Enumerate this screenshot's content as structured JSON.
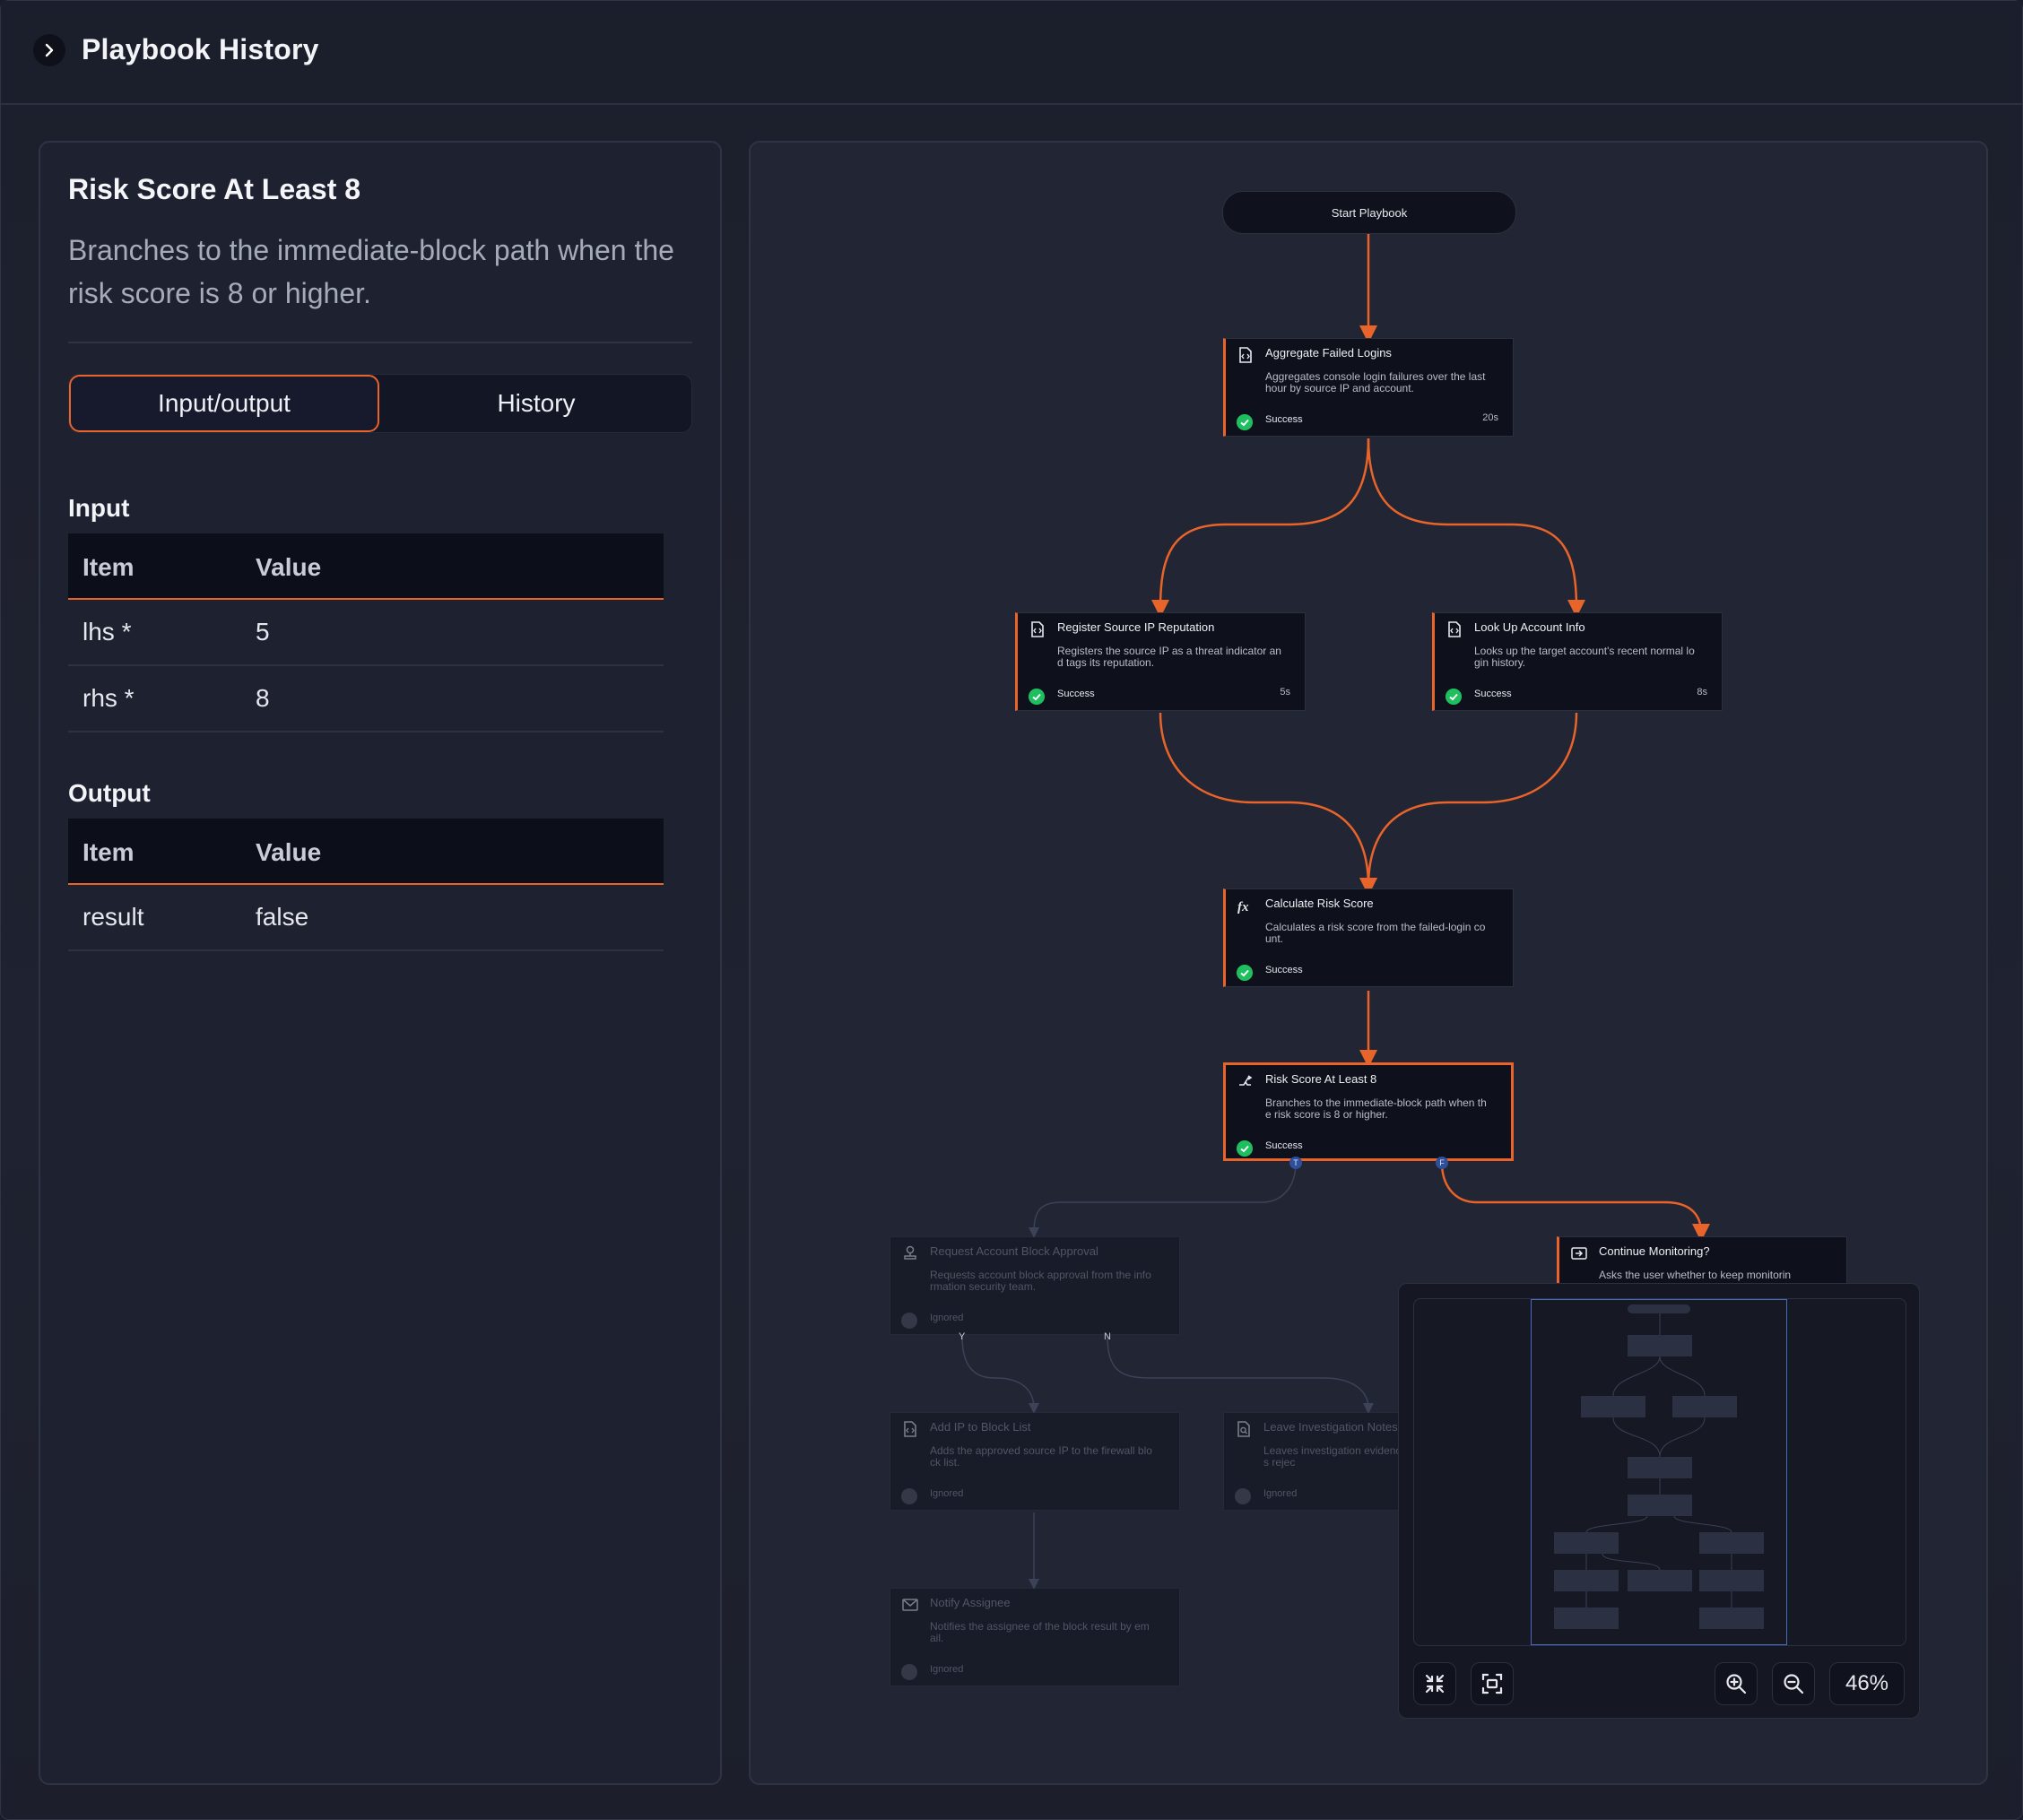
{
  "header": {
    "title": "Playbook History"
  },
  "detail": {
    "title": "Risk Score At Least 8",
    "description": "Branches to the immediate-block path when the risk score is 8 or higher.",
    "tabs": {
      "active": "Input/output",
      "inactive": "History"
    },
    "input": {
      "heading": "Input",
      "columns": [
        "Item",
        "Value"
      ],
      "rows": [
        {
          "item": "lhs *",
          "value": "5"
        },
        {
          "item": "rhs *",
          "value": "8"
        }
      ]
    },
    "output": {
      "heading": "Output",
      "columns": [
        "Item",
        "Value"
      ],
      "rows": [
        {
          "item": "result",
          "value": "false"
        }
      ]
    }
  },
  "flow": {
    "start": "Start Playbook",
    "nodes": {
      "aggregate": {
        "title": "Aggregate Failed Logins",
        "desc": "Aggregates console login failures over the last hour by source IP and account.",
        "status": "Success",
        "time": "20s"
      },
      "register": {
        "title": "Register Source IP Reputation",
        "desc": "Registers the source IP as a threat indicator and tags its reputation.",
        "status": "Success",
        "time": "5s"
      },
      "lookup": {
        "title": "Look Up Account Info",
        "desc": "Looks up the target account's recent normal login history.",
        "status": "Success",
        "time": "8s"
      },
      "calculate": {
        "title": "Calculate Risk Score",
        "desc": "Calculates a risk score from the failed-login count.",
        "status": "Success"
      },
      "risk": {
        "title": "Risk Score At Least 8",
        "desc": "Branches to the immediate-block path when the risk score is 8 or higher.",
        "status": "Success"
      },
      "request": {
        "title": "Request Account Block Approval",
        "desc": "Requests account block approval from the information security team.",
        "status": "Ignored"
      },
      "continue": {
        "title": "Continue Monitoring?",
        "desc": "Asks the user whether to keep monitorin"
      },
      "addip": {
        "title": "Add IP to Block List",
        "desc": "Adds the approved source IP to the firewall block list.",
        "status": "Ignored"
      },
      "leave": {
        "title": "Leave Investigation Notes",
        "desc": "Leaves investigation evidence when approval is rejec",
        "status": "Ignored"
      },
      "notify": {
        "title": "Notify Assignee",
        "desc": "Notifies the assignee of the block result by email.",
        "status": "Ignored"
      }
    },
    "ports": {
      "true": "T",
      "false": "F",
      "yes": "Y",
      "no": "N"
    }
  },
  "minimap": {
    "zoom": "46%"
  },
  "colors": {
    "accent": "#e8642a",
    "success": "#1fbf5f",
    "port": "#2f4f9a"
  }
}
